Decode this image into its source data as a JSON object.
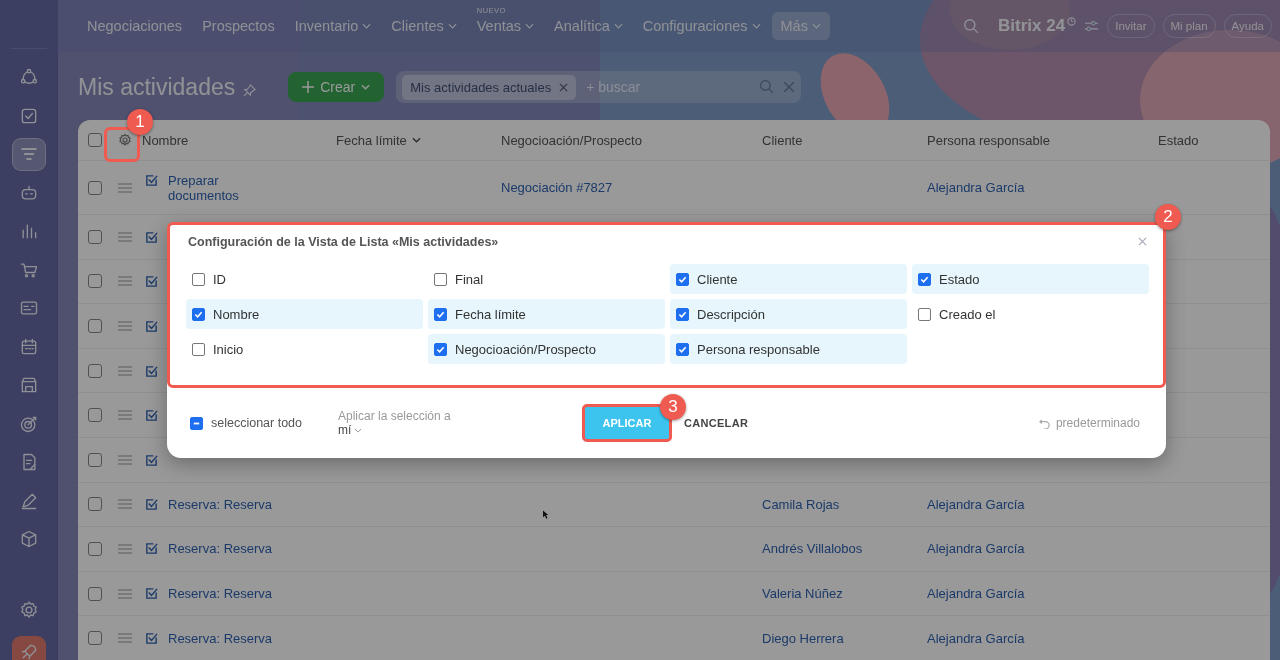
{
  "topbar": {
    "nav": [
      {
        "label": "Negociaciones",
        "caret": false,
        "selected": false
      },
      {
        "label": "Prospectos",
        "caret": false,
        "selected": false
      },
      {
        "label": "Inventario",
        "caret": true,
        "selected": false
      },
      {
        "label": "Clientes",
        "caret": true,
        "selected": false
      },
      {
        "label": "Ventas",
        "caret": true,
        "selected": false,
        "badge": "NUEVO"
      },
      {
        "label": "Analítica",
        "caret": true,
        "selected": false
      },
      {
        "label": "Configuraciones",
        "caret": true,
        "selected": false
      },
      {
        "label": "Más",
        "caret": true,
        "selected": true
      }
    ],
    "logo": "Bitrix 24",
    "buttons": [
      "Invitar",
      "Mi plan",
      "Ayuda"
    ]
  },
  "sidebar": {
    "items": [
      {
        "kind": "network",
        "selected": false
      },
      {
        "kind": "task",
        "selected": false
      },
      {
        "kind": "filter",
        "selected": true
      },
      {
        "kind": "robot",
        "selected": false
      },
      {
        "kind": "chart",
        "selected": false
      },
      {
        "kind": "cart",
        "selected": false
      },
      {
        "kind": "card",
        "selected": false
      },
      {
        "kind": "calendar",
        "selected": false
      },
      {
        "kind": "store",
        "selected": false
      },
      {
        "kind": "target",
        "selected": false
      },
      {
        "kind": "document",
        "selected": false
      },
      {
        "kind": "pen",
        "selected": false
      },
      {
        "kind": "box",
        "selected": false
      },
      {
        "kind": "settings",
        "selected": false
      },
      {
        "kind": "rocket",
        "selected": false
      }
    ]
  },
  "header": {
    "title": "Mis actividades",
    "create": "Crear",
    "filter_chip": "Mis actividades actuales",
    "search": {
      "placeholder": "+ buscar"
    }
  },
  "table": {
    "all_checked": false,
    "columns": [
      {
        "label": "Nombre",
        "sorted": false
      },
      {
        "label": "Fecha límite",
        "sorted": true
      },
      {
        "label": "Negocioación/Prospecto",
        "sorted": false
      },
      {
        "label": "Cliente",
        "sorted": false
      },
      {
        "label": "Persona responsable",
        "sorted": false
      },
      {
        "label": "Estado",
        "sorted": false
      }
    ],
    "rows": [
      {
        "checked": false,
        "name": "Preparar documentos",
        "deal": "Negociación #7827",
        "responsible": "Alejandra García"
      },
      {
        "checked": false
      },
      {
        "checked": false
      },
      {
        "checked": false
      },
      {
        "checked": false
      },
      {
        "checked": false
      },
      {
        "checked": false
      },
      {
        "checked": false,
        "name": "Reserva: Reserva",
        "client": "Camila Rojas",
        "responsible": "Alejandra García"
      },
      {
        "checked": false,
        "name": "Reserva: Reserva",
        "client": "Andrés Villalobos",
        "responsible": "Alejandra García"
      },
      {
        "checked": false,
        "name": "Reserva: Reserva",
        "client": "Valeria Núñez",
        "responsible": "Alejandra García"
      },
      {
        "checked": false,
        "name": "Reserva: Reserva",
        "client": "Diego Herrera",
        "responsible": "Alejandra García"
      }
    ]
  },
  "dialog": {
    "title": "Configuración de la Vista de Lista «Mis actividades»",
    "fields": [
      {
        "label": "ID",
        "checked": false
      },
      {
        "label": "Final",
        "checked": false
      },
      {
        "label": "Cliente",
        "checked": true
      },
      {
        "label": "Estado",
        "checked": true
      },
      {
        "label": "Nombre",
        "checked": true
      },
      {
        "label": "Fecha límite",
        "checked": true
      },
      {
        "label": "Descripción",
        "checked": true
      },
      {
        "label": "Creado el",
        "checked": false
      },
      {
        "label": "Inicio",
        "checked": false
      },
      {
        "label": "Negocioación/Prospecto",
        "checked": true
      },
      {
        "label": "Persona responsable",
        "checked": true
      }
    ],
    "select_all": {
      "label": "seleccionar todo",
      "indeterminate": true
    },
    "apply_to": {
      "label": "Aplicar la selección a",
      "value": "mí"
    },
    "apply": "APLICAR",
    "cancel": "CANCELAR",
    "reset": "predeterminado"
  },
  "annotations": [
    "1",
    "2",
    "3"
  ]
}
